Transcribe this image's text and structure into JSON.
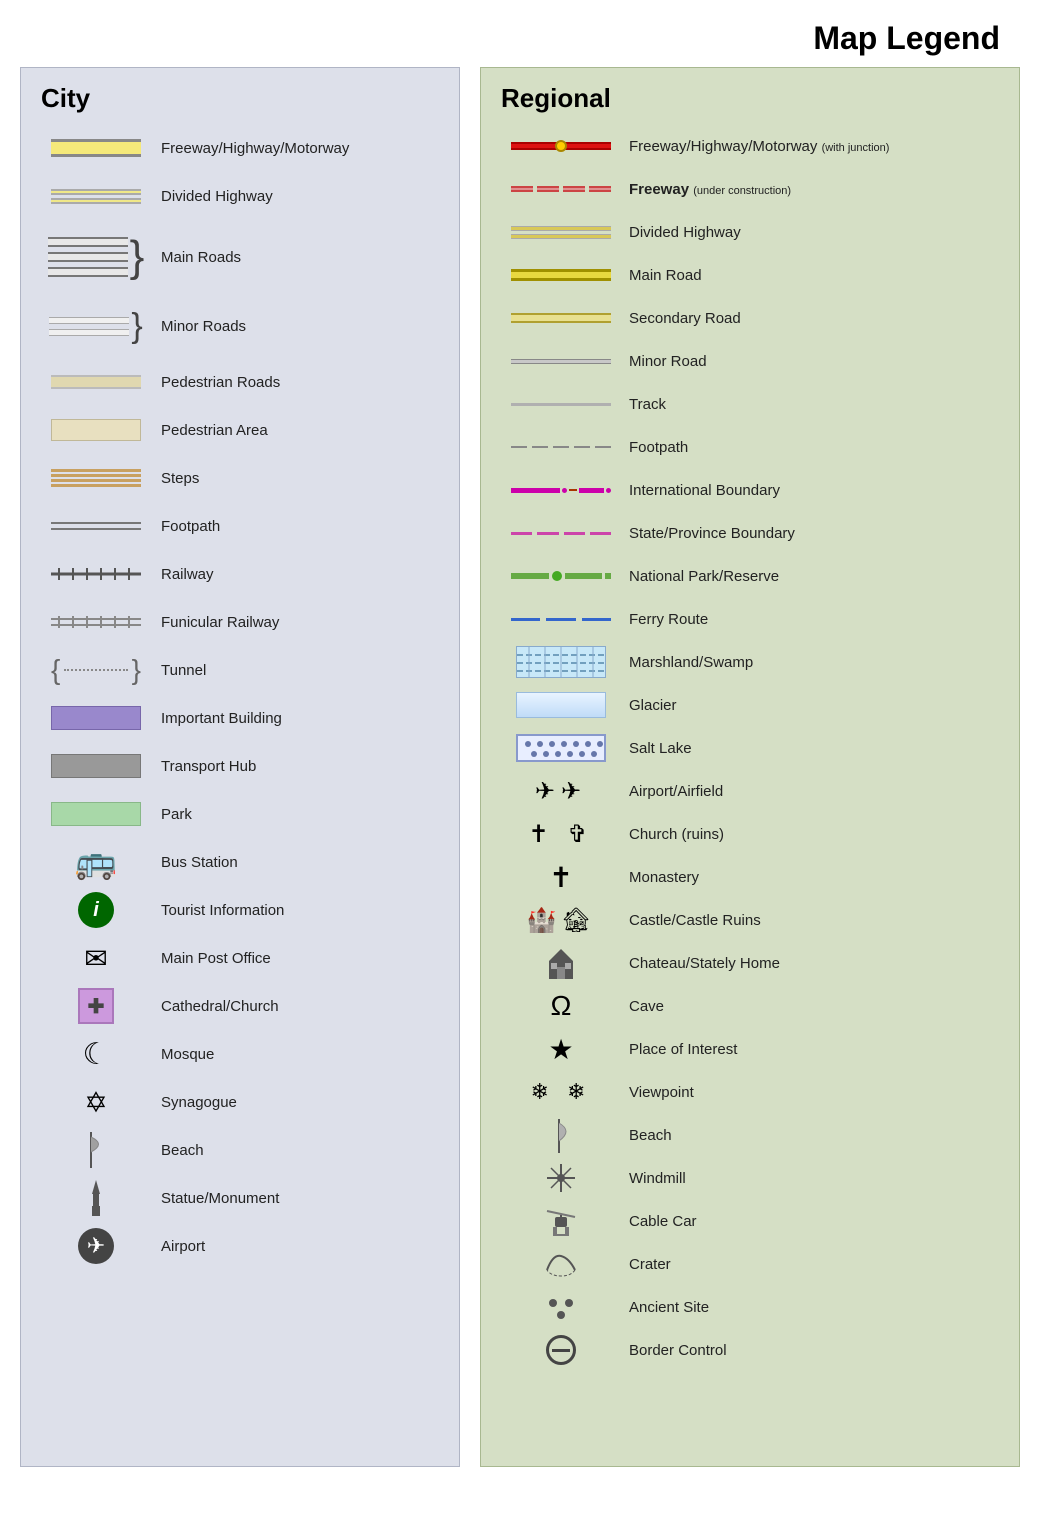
{
  "title": "Map Legend",
  "city": {
    "panel_title": "City",
    "items": [
      {
        "id": "freeway",
        "label": "Freeway/Highway/Motorway",
        "type": "road-freeway"
      },
      {
        "id": "divided-highway",
        "label": "Divided Highway",
        "type": "road-divided"
      },
      {
        "id": "main-roads",
        "label": "Main Roads",
        "type": "main-roads-brace"
      },
      {
        "id": "minor-roads",
        "label": "Minor Roads",
        "type": "minor-roads-brace"
      },
      {
        "id": "pedestrian-roads",
        "label": "Pedestrian Roads",
        "type": "pedestrian-roads"
      },
      {
        "id": "pedestrian-area",
        "label": "Pedestrian Area",
        "type": "pedestrian-area"
      },
      {
        "id": "steps",
        "label": "Steps",
        "type": "steps"
      },
      {
        "id": "footpath",
        "label": "Footpath",
        "type": "footpath"
      },
      {
        "id": "railway",
        "label": "Railway",
        "type": "railway"
      },
      {
        "id": "funicular",
        "label": "Funicular Railway",
        "type": "funicular"
      },
      {
        "id": "tunnel",
        "label": "Tunnel",
        "type": "tunnel"
      },
      {
        "id": "important-building",
        "label": "Important Building",
        "type": "important-building"
      },
      {
        "id": "transport-hub",
        "label": "Transport Hub",
        "type": "transport-hub"
      },
      {
        "id": "park",
        "label": "Park",
        "type": "park"
      },
      {
        "id": "bus-station",
        "label": "Bus Station",
        "type": "icon",
        "icon": "🚌"
      },
      {
        "id": "tourist-info",
        "label": "Tourist Information",
        "type": "icon-circle",
        "icon": "ℹ",
        "color": "#006600"
      },
      {
        "id": "post-office",
        "label": "Main Post Office",
        "type": "icon",
        "icon": "✉"
      },
      {
        "id": "cathedral",
        "label": "Cathedral/Church",
        "type": "icon-box",
        "icon": "✚",
        "color": "#9988cc"
      },
      {
        "id": "mosque",
        "label": "Mosque",
        "type": "icon",
        "icon": "☾"
      },
      {
        "id": "synagogue",
        "label": "Synagogue",
        "type": "icon",
        "icon": "✡"
      },
      {
        "id": "beach-city",
        "label": "Beach",
        "type": "icon",
        "icon": "🏖"
      },
      {
        "id": "statue",
        "label": "Statue/Monument",
        "type": "icon",
        "icon": "🗿"
      },
      {
        "id": "airport-city",
        "label": "Airport",
        "type": "icon",
        "icon": "✈"
      }
    ]
  },
  "regional": {
    "panel_title": "Regional",
    "items": [
      {
        "id": "reg-freeway",
        "label": "Freeway/Highway/Motorway",
        "sublabel": "(with junction)",
        "type": "reg-freeway"
      },
      {
        "id": "reg-freeway-construction",
        "label": "Freeway",
        "sublabel": "(under construction)",
        "type": "reg-freeway-construction"
      },
      {
        "id": "reg-divided",
        "label": "Divided Highway",
        "type": "reg-divided"
      },
      {
        "id": "reg-main-road",
        "label": "Main Road",
        "type": "reg-main-road"
      },
      {
        "id": "reg-secondary",
        "label": "Secondary Road",
        "type": "reg-secondary"
      },
      {
        "id": "reg-minor",
        "label": "Minor Road",
        "type": "reg-minor"
      },
      {
        "id": "reg-track",
        "label": "Track",
        "type": "reg-track"
      },
      {
        "id": "reg-footpath",
        "label": "Footpath",
        "type": "reg-footpath"
      },
      {
        "id": "int-boundary",
        "label": "International Boundary",
        "type": "int-boundary"
      },
      {
        "id": "state-boundary",
        "label": "State/Province Boundary",
        "type": "state-boundary"
      },
      {
        "id": "national-park",
        "label": "National Park/Reserve",
        "type": "national-park"
      },
      {
        "id": "ferry",
        "label": "Ferry Route",
        "type": "ferry"
      },
      {
        "id": "marshland",
        "label": "Marshland/Swamp",
        "type": "marshland"
      },
      {
        "id": "glacier",
        "label": "Glacier",
        "type": "glacier"
      },
      {
        "id": "salt-lake",
        "label": "Salt Lake",
        "type": "salt-lake"
      },
      {
        "id": "airport-reg",
        "label": "Airport/Airfield",
        "type": "text-icon",
        "icon": "✈✈"
      },
      {
        "id": "church-reg",
        "label": "Church (ruins)",
        "type": "text-icon",
        "icon": "✝ ✝̈"
      },
      {
        "id": "monastery",
        "label": "Monastery",
        "type": "text-icon",
        "icon": "✝"
      },
      {
        "id": "castle",
        "label": "Castle/Castle Ruins",
        "type": "text-icon",
        "icon": "🏰🏚"
      },
      {
        "id": "chateau",
        "label": "Chateau/Stately Home",
        "type": "text-icon",
        "icon": "🏛"
      },
      {
        "id": "cave",
        "label": "Cave",
        "type": "text-icon",
        "icon": "Ω"
      },
      {
        "id": "place-of-interest",
        "label": "Place of Interest",
        "type": "text-icon",
        "icon": "★"
      },
      {
        "id": "viewpoint",
        "label": "Viewpoint",
        "type": "text-icon",
        "icon": "❄ ❄"
      },
      {
        "id": "beach-reg",
        "label": "Beach",
        "type": "text-icon",
        "icon": "🏖"
      },
      {
        "id": "windmill",
        "label": "Windmill",
        "type": "text-icon",
        "icon": "⚙"
      },
      {
        "id": "cable-car",
        "label": "Cable Car",
        "type": "text-icon",
        "icon": "🚡"
      },
      {
        "id": "crater",
        "label": "Crater",
        "type": "text-icon",
        "icon": "⟲"
      },
      {
        "id": "ancient-site",
        "label": "Ancient Site",
        "type": "text-icon",
        "icon": "∵"
      },
      {
        "id": "border-control",
        "label": "Border Control",
        "type": "text-icon",
        "icon": "⊖"
      }
    ]
  }
}
